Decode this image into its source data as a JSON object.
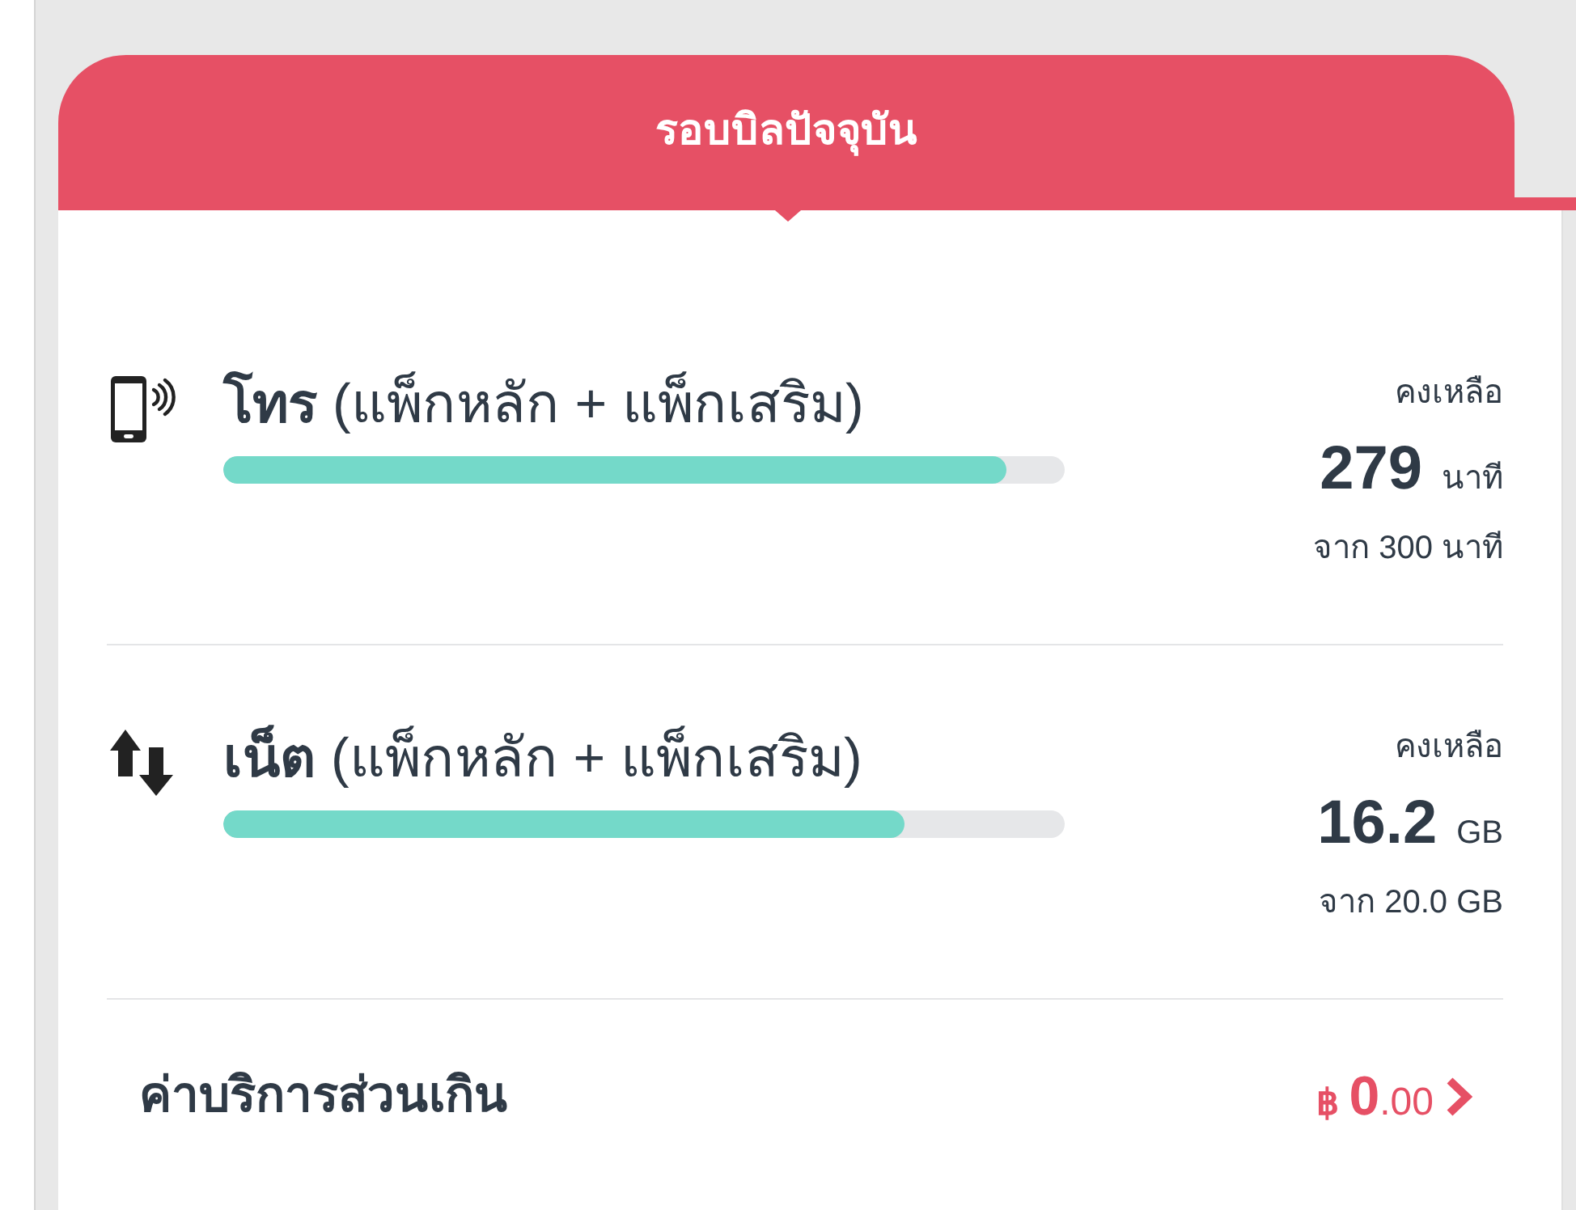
{
  "header": {
    "title": "รอบบิลปัจจุบัน"
  },
  "usage": [
    {
      "kind": "voice",
      "title": "**โทร** (แพ็กหลัก + แพ็กเสริม)",
      "level": 0.93,
      "remaining_label": "คงเหลือ",
      "remaining": "279",
      "unit": "นาที",
      "total": "จาก 300 นาที"
    },
    {
      "kind": "data",
      "title": "**เน็ต** (แพ็กหลัก + แพ็กเสริม)",
      "level": 0.81,
      "remaining_label": "คงเหลือ",
      "remaining": "16.2",
      "unit": "GB",
      "total": "จาก 20.0 GB"
    }
  ],
  "overage": {
    "label": "ค่าบริการส่วนเกิน",
    "currency": "฿",
    "amount": "0",
    "decimals": ".00"
  }
}
